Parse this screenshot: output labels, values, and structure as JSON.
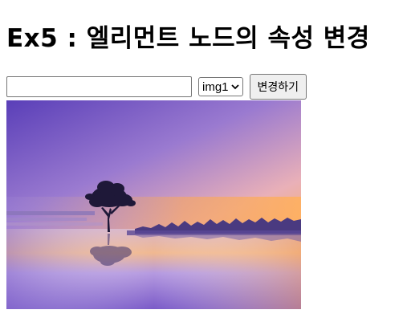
{
  "header": {
    "title": "Ex5 : 엘리먼트 노드의 속성 변경"
  },
  "form": {
    "text_input_value": "",
    "select_selected": "img1",
    "button_label": "변경하기"
  },
  "image": {
    "description_icon": "landscape-tree-sunset",
    "colors": {
      "sky_top": "#6a4fc0",
      "sky_mid": "#b58ad8",
      "horizon": "#f4a660",
      "water": "#9a7ad8"
    }
  }
}
